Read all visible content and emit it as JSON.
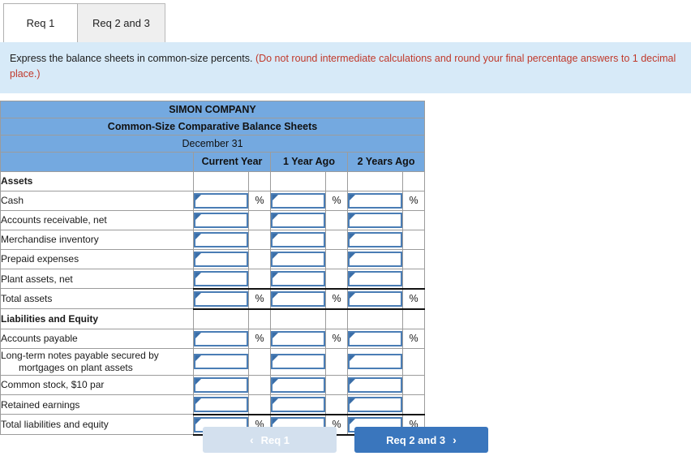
{
  "tabs": [
    {
      "label": "Req 1",
      "active": true
    },
    {
      "label": "Req 2 and 3",
      "active": false
    }
  ],
  "instructions": {
    "main": "Express the balance sheets in common-size percents.",
    "hint": "(Do not round intermediate calculations and round your final percentage answers to 1 decimal place.)"
  },
  "sheet": {
    "company": "SIMON COMPANY",
    "statement": "Common-Size Comparative Balance Sheets",
    "period": "December 31",
    "columns": [
      "Current Year",
      "1 Year Ago",
      "2 Years Ago"
    ],
    "percent_symbol": "%",
    "rows": [
      {
        "label": "Assets",
        "type": "section"
      },
      {
        "label": "Cash",
        "type": "input",
        "percent": true
      },
      {
        "label": "Accounts receivable, net",
        "type": "input",
        "percent": false
      },
      {
        "label": "Merchandise inventory",
        "type": "input",
        "percent": false
      },
      {
        "label": "Prepaid expenses",
        "type": "input",
        "percent": false
      },
      {
        "label": "Plant assets, net",
        "type": "input",
        "percent": false
      },
      {
        "label": "Total assets",
        "type": "total",
        "percent": true
      },
      {
        "label": "Liabilities and Equity",
        "type": "section"
      },
      {
        "label": "Accounts payable",
        "type": "input",
        "percent": true
      },
      {
        "label": "Long-term notes payable secured by",
        "label2": "mortgages on plant assets",
        "type": "input",
        "percent": false
      },
      {
        "label": "Common stock, $10 par",
        "type": "input",
        "percent": false
      },
      {
        "label": "Retained earnings",
        "type": "input",
        "percent": false
      },
      {
        "label": "Total liabilities and equity",
        "type": "grand",
        "percent": true
      }
    ]
  },
  "nav": {
    "prev_label": "Req 1",
    "prev_icon": "chevron-left",
    "next_label": "Req 2 and 3",
    "next_icon": "chevron-right"
  },
  "colors": {
    "header_blue": "#74a9e0",
    "banner_blue": "#d7eaf8",
    "primary_button": "#3a76bd",
    "disabled_button": "#d3e0ee",
    "hint_red": "#c0392b",
    "input_border": "#4a7db5"
  }
}
